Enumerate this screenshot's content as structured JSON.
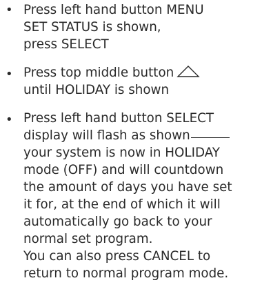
{
  "steps": [
    {
      "lines": [
        "Press left hand button MENU",
        "SET STATUS is shown,",
        "press SELECT"
      ]
    },
    {
      "lines": [
        "Press top middle button",
        "until HOLIDAY is shown"
      ],
      "icon": "up-triangle-icon"
    },
    {
      "lines": [
        "Press left hand button SELECT",
        "display will flash as shown",
        "your system is now in HOLIDAY",
        "mode (OFF) and will countdown",
        "the amount of days you have set",
        "it for, at the end of which it will",
        "automatically go back to your",
        "normal set program.",
        "You can also press CANCEL to",
        "return to normal program mode."
      ]
    }
  ],
  "bullet_char": "•"
}
